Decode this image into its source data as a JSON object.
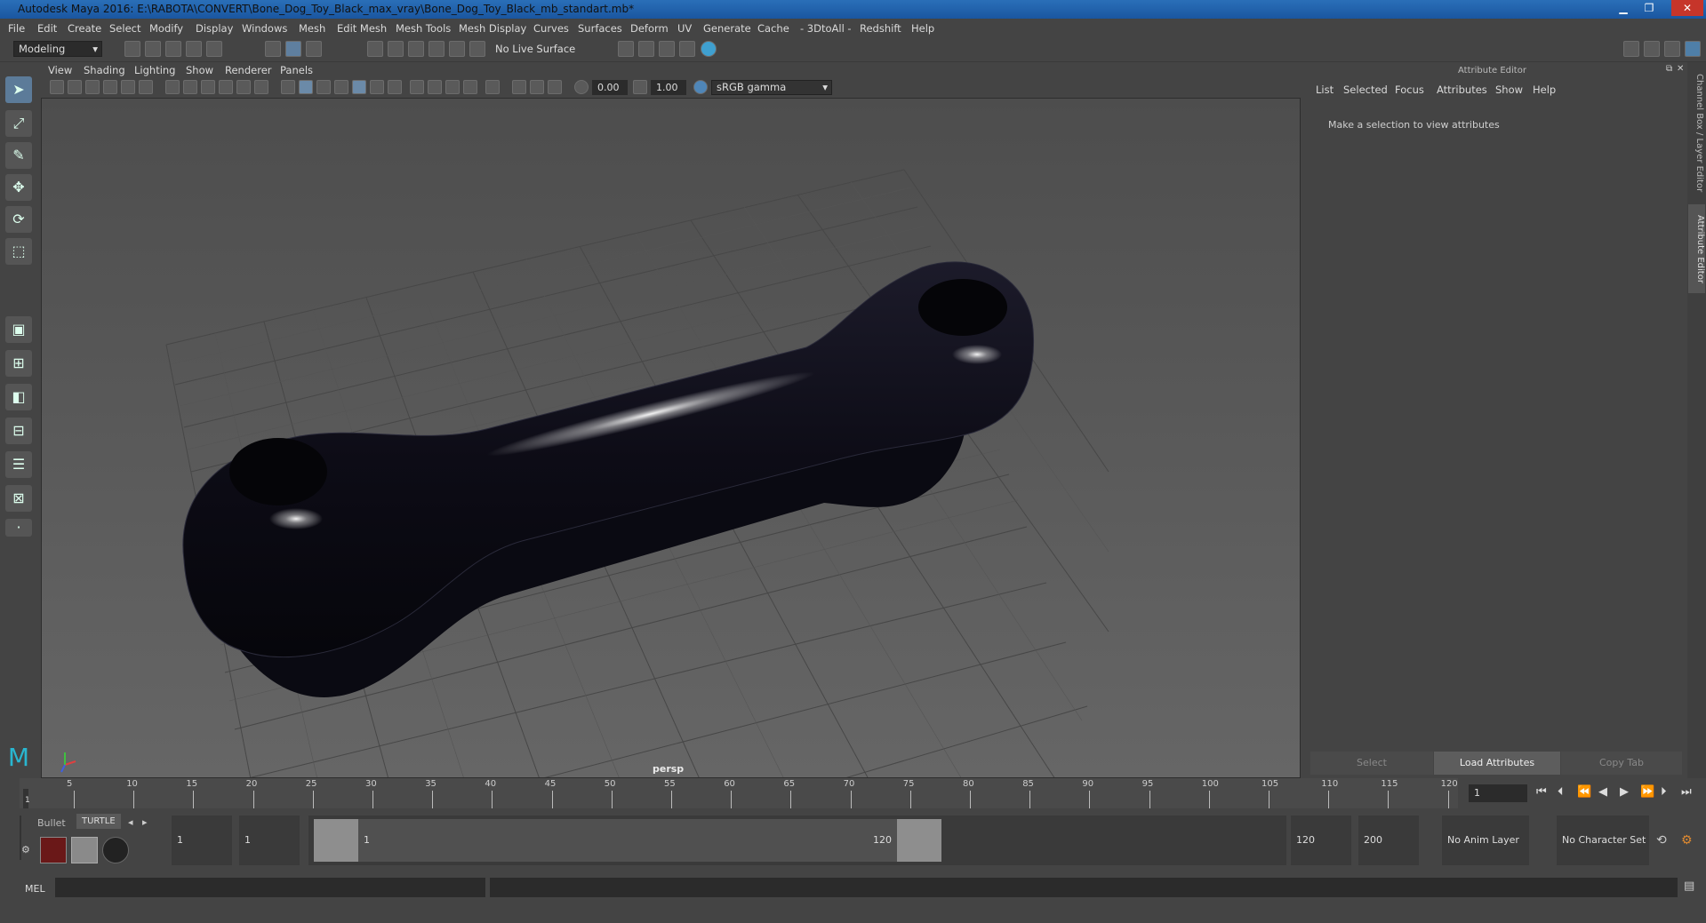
{
  "window": {
    "title": "Autodesk Maya 2016: E:\\RABOTA\\CONVERT\\Bone_Dog_Toy_Black_max_vray\\Bone_Dog_Toy_Black_mb_standart.mb*",
    "minimize": "▁",
    "restore": "❐",
    "close": "✕"
  },
  "menu": [
    "File",
    "Edit",
    "Create",
    "Select",
    "Modify",
    "Display",
    "Windows",
    "Mesh",
    "Edit Mesh",
    "Mesh Tools",
    "Mesh Display",
    "Curves",
    "Surfaces",
    "Deform",
    "UV",
    "Generate",
    "Cache",
    "- 3DtoAll -",
    "Redshift",
    "Help"
  ],
  "shelf": {
    "mode": "Modeling",
    "live_surface": "No Live Surface"
  },
  "viewport": {
    "menu": [
      "View",
      "Shading",
      "Lighting",
      "Show",
      "Renderer",
      "Panels"
    ],
    "exposure": "0.00",
    "gamma": "1.00",
    "color_space": "sRGB gamma",
    "camera_label": "persp"
  },
  "attribute_editor": {
    "header": "Attribute Editor",
    "tabs": [
      "List",
      "Selected",
      "Focus",
      "Attributes",
      "Show",
      "Help"
    ],
    "message": "Make a selection to view attributes",
    "buttons": {
      "select": "Select",
      "load": "Load Attributes",
      "copy": "Copy Tab"
    }
  },
  "side_tabs": {
    "channel_box": "Channel Box / Layer Editor",
    "attribute_editor": "Attribute Editor"
  },
  "timeline": {
    "ticks": [
      "5",
      "10",
      "15",
      "20",
      "25",
      "30",
      "35",
      "40",
      "45",
      "50",
      "55",
      "60",
      "65",
      "70",
      "75",
      "80",
      "85",
      "90",
      "95",
      "100",
      "105",
      "110",
      "115",
      "120"
    ],
    "start_marker": "1",
    "current_frame": "1"
  },
  "range": {
    "shelf_tabs": {
      "bullet": "Bullet",
      "turtle": "TURTLE"
    },
    "start": "1",
    "playback_start": "1",
    "slider_start_label": "1",
    "slider_end_label": "120",
    "playback_end": "120",
    "end": "200",
    "anim_layer": "No Anim Layer",
    "character_set": "No Character Set"
  },
  "command": {
    "label": "MEL"
  }
}
